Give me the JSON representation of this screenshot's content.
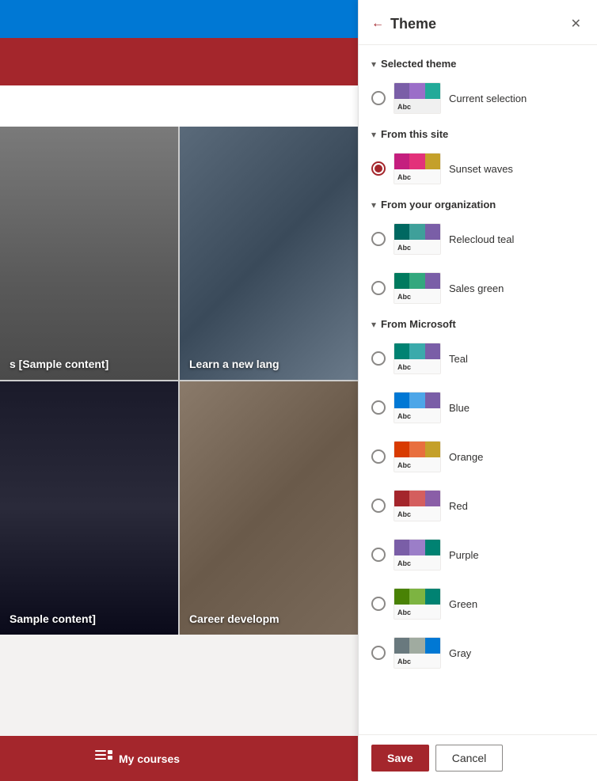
{
  "app": {
    "title": "Theme"
  },
  "panel": {
    "title": "Theme",
    "back_label": "←",
    "close_label": "✕",
    "sections": [
      {
        "id": "selected-theme",
        "label": "Selected theme",
        "themes": [
          {
            "id": "current",
            "name": "Current selection",
            "selected": false,
            "swatch_class": "swatch-current"
          }
        ]
      },
      {
        "id": "from-this-site",
        "label": "From this site",
        "themes": [
          {
            "id": "sunset-waves",
            "name": "Sunset waves",
            "selected": true,
            "swatch_class": "swatch-sunset"
          }
        ]
      },
      {
        "id": "from-your-org",
        "label": "From your organization",
        "themes": [
          {
            "id": "relecloud-teal",
            "name": "Relecloud teal",
            "selected": false,
            "swatch_class": "swatch-relecloud"
          },
          {
            "id": "sales-green",
            "name": "Sales green",
            "selected": false,
            "swatch_class": "swatch-salesgreen"
          }
        ]
      },
      {
        "id": "from-microsoft",
        "label": "From Microsoft",
        "themes": [
          {
            "id": "teal",
            "name": "Teal",
            "selected": false,
            "swatch_class": "swatch-teal"
          },
          {
            "id": "blue",
            "name": "Blue",
            "selected": false,
            "swatch_class": "swatch-blue"
          },
          {
            "id": "orange",
            "name": "Orange",
            "selected": false,
            "swatch_class": "swatch-orange"
          },
          {
            "id": "red",
            "name": "Red",
            "selected": false,
            "swatch_class": "swatch-red"
          },
          {
            "id": "purple",
            "name": "Purple",
            "selected": false,
            "swatch_class": "swatch-purple"
          },
          {
            "id": "green",
            "name": "Green",
            "selected": false,
            "swatch_class": "swatch-green"
          },
          {
            "id": "gray",
            "name": "Gray",
            "selected": false,
            "swatch_class": "swatch-gray"
          }
        ]
      }
    ],
    "footer": {
      "save_label": "Save",
      "cancel_label": "Cancel"
    }
  },
  "left": {
    "cards": [
      {
        "id": "card1",
        "label": "s [Sample content]",
        "img_class": "img-card-1"
      },
      {
        "id": "card2",
        "label": "Learn a new lang",
        "img_class": "img-card-2"
      },
      {
        "id": "card3",
        "label": "Sample content]",
        "img_class": "img-card-3"
      },
      {
        "id": "card4",
        "label": "Career developm",
        "img_class": "img-card-4"
      }
    ],
    "bottom_nav": {
      "label": "My courses",
      "icon": "☰"
    }
  }
}
